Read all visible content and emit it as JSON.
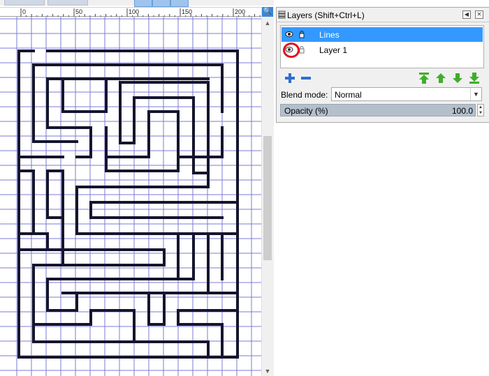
{
  "ruler": {
    "ticks": [
      "0",
      "50",
      "100",
      "150",
      "200"
    ]
  },
  "layers_panel": {
    "title": "Layers (Shift+Ctrl+L)",
    "layers": [
      {
        "name": "Lines",
        "selected": true,
        "visible": true
      },
      {
        "name": "Layer 1",
        "selected": false,
        "visible": true
      }
    ],
    "blend_mode": {
      "label": "Blend mode:",
      "value": "Normal"
    },
    "opacity": {
      "label": "Opacity (%)",
      "value": "100.0"
    }
  },
  "icons": {
    "zoom": "magnifier-icon",
    "layer_visible": "eye-icon",
    "layer_lock": "lock-icon",
    "add_layer": "plus-icon",
    "remove_layer": "minus-icon",
    "raise_to_top": "raise-to-top-icon",
    "raise": "raise-icon",
    "lower": "lower-icon",
    "lower_to_bottom": "lower-to-bottom-icon"
  },
  "colors": {
    "selection": "#3399ff",
    "grid": "#7b7bd6",
    "maze_line": "#15152e",
    "highlight_circle": "#e0141e",
    "button_blue": "#2f6fd0",
    "button_green": "#3fae2a"
  }
}
